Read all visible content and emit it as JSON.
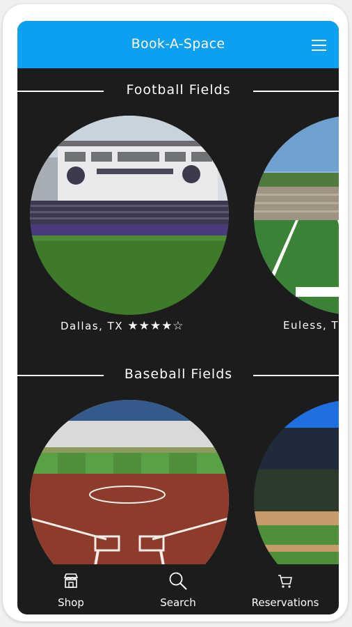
{
  "app": {
    "title": "Book-A-Space"
  },
  "header": {
    "menu_icon": "hamburger-menu-icon",
    "background_color": "#0d9ff0"
  },
  "sections": [
    {
      "title": "Football Fields",
      "cards": [
        {
          "location": "Dallas, TX",
          "rating": 4,
          "rating_max": 5,
          "stars": "★★★★☆"
        },
        {
          "location": "Euless, T"
        }
      ]
    },
    {
      "title": "Baseball Fields",
      "cards": [
        {
          "location": ""
        },
        {
          "location": ""
        }
      ]
    }
  ],
  "tabbar": {
    "items": [
      {
        "label": "Shop",
        "icon": "shop-icon"
      },
      {
        "label": "Search",
        "icon": "search-icon"
      },
      {
        "label": "Reservations",
        "icon": "cart-icon"
      }
    ]
  },
  "colors": {
    "screen_background": "#1c1c1c",
    "text": "#ffffff"
  }
}
